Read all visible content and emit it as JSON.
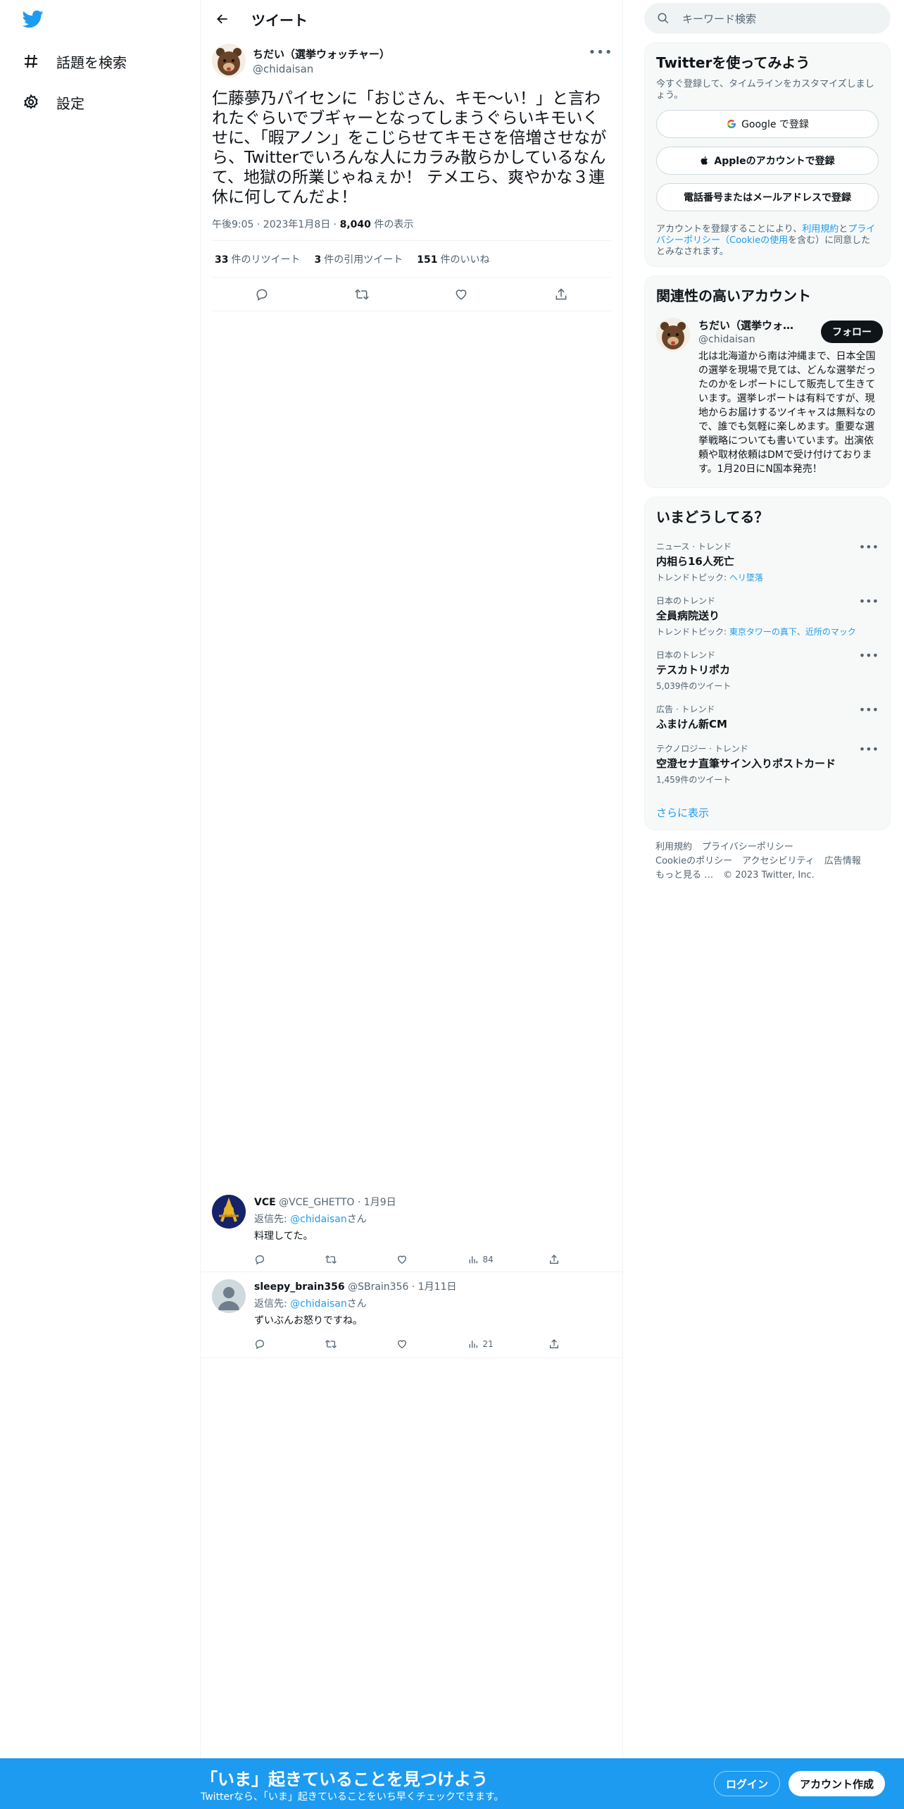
{
  "sidebar": {
    "explore_label": "話題を検索",
    "settings_label": "設定"
  },
  "header": {
    "title": "ツイート"
  },
  "tweet": {
    "display_name": "ちだい（選挙ウォッチャー）",
    "handle": "@chidaisan",
    "text": "仁藤夢乃パイセンに「おじさん、キモ～い！」と言われたぐらいでブギャーとなってしまうぐらいキモいくせに、「暇アノン」をこじらせてキモさを倍増させながら、Twitterでいろんな人にカラみ散らかしているなんて、地獄の所業じゃねぇか！ テメエら、爽やかな３連休に何してんだよ！",
    "time": "午後9:05 · 2023年1月8日 · ",
    "views_count": "8,040",
    "views_label": " 件の表示",
    "retweets_count": "33",
    "retweets_label": "件のリツイート",
    "quotes_count": "3",
    "quotes_label": "件の引用ツイート",
    "likes_count": "151",
    "likes_label": "件のいいね"
  },
  "replies": [
    {
      "name": "VCE",
      "handle": "@VCE_GHETTO · 1月9日",
      "reply_prefix": "返信先: ",
      "reply_to": "@chidaisan",
      "reply_suffix": "さん",
      "text": "料理してた。",
      "views": "84"
    },
    {
      "name": "sleepy_brain356",
      "handle": "@SBrain356 · 1月11日",
      "reply_prefix": "返信先: ",
      "reply_to": "@chidaisan",
      "reply_suffix": "さん",
      "text": "ずいぶんお怒りですね。",
      "views": "21"
    }
  ],
  "search": {
    "placeholder": "キーワード検索"
  },
  "signup_card": {
    "title": "Twitterを使ってみよう",
    "subtitle": "今すぐ登録して、タイムラインをカスタマイズしましょう。",
    "google_label": "Google で登録",
    "apple_label": "Appleのアカウントで登録",
    "email_label": "電話番号またはメールアドレスで登録",
    "terms_prefix": "アカウントを登録することにより、",
    "terms_link1": "利用規約",
    "terms_and": "と",
    "terms_link2": "プライバシーポリシー（Cookieの使用",
    "terms_suffix": "を含む）に同意したとみなされます。"
  },
  "related": {
    "title": "関連性の高いアカウント",
    "name": "ちだい（選挙ウォッチャー）",
    "handle": "@chidaisan",
    "follow_label": "フォロー",
    "bio": "北は北海道から南は沖縄まで、日本全国の選挙を現場で見ては、どんな選挙だったのかをレポートにして販売して生きています。選挙レポートは有料ですが、現地からお届けするツイキャスは無料なので、誰でも気軽に楽しめます。重要な選挙戦略についても書いています。出演依頼や取材依頼はDMで受け付けております。1月20日にN国本発売！"
  },
  "trends": {
    "title": "いまどうしてる？",
    "items": [
      {
        "category": "ニュース · トレンド",
        "name": "内相ら16人死亡",
        "sub_prefix": "トレンドトピック: ",
        "sub_link": "ヘリ墜落",
        "sub_link2": ""
      },
      {
        "category": "日本のトレンド",
        "name": "全員病院送り",
        "sub_prefix": "トレンドトピック: ",
        "sub_link": "東京タワーの真下",
        "sub_link2": "、近所のマック"
      },
      {
        "category": "日本のトレンド",
        "name": "テスカトリポカ",
        "sub_prefix": "5,039件のツイート",
        "sub_link": "",
        "sub_link2": ""
      },
      {
        "category": "広告 · トレンド",
        "name": "ふまけん新CM",
        "sub_prefix": "",
        "sub_link": "",
        "sub_link2": ""
      },
      {
        "category": "テクノロジー · トレンド",
        "name": "空澄セナ直筆サイン入りポストカード",
        "sub_prefix": "1,459件のツイート",
        "sub_link": "",
        "sub_link2": ""
      }
    ],
    "show_more": "さらに表示"
  },
  "footer": {
    "terms": "利用規約",
    "privacy": "プライバシーポリシー",
    "cookie": "Cookieのポリシー",
    "accessibility": "アクセシビリティ",
    "ads": "広告情報",
    "more": "もっと見る …",
    "copyright": "© 2023 Twitter, Inc."
  },
  "bottom_bar": {
    "title": "「いま」起きていることを見つけよう",
    "subtitle": "Twitterなら、「いま」起きていることをいち早くチェックできます。",
    "login_label": "ログイン",
    "signup_label": "アカウント作成"
  },
  "colors": {
    "accent": "#1d9bf0",
    "text": "#0f1419",
    "muted": "#536471"
  }
}
